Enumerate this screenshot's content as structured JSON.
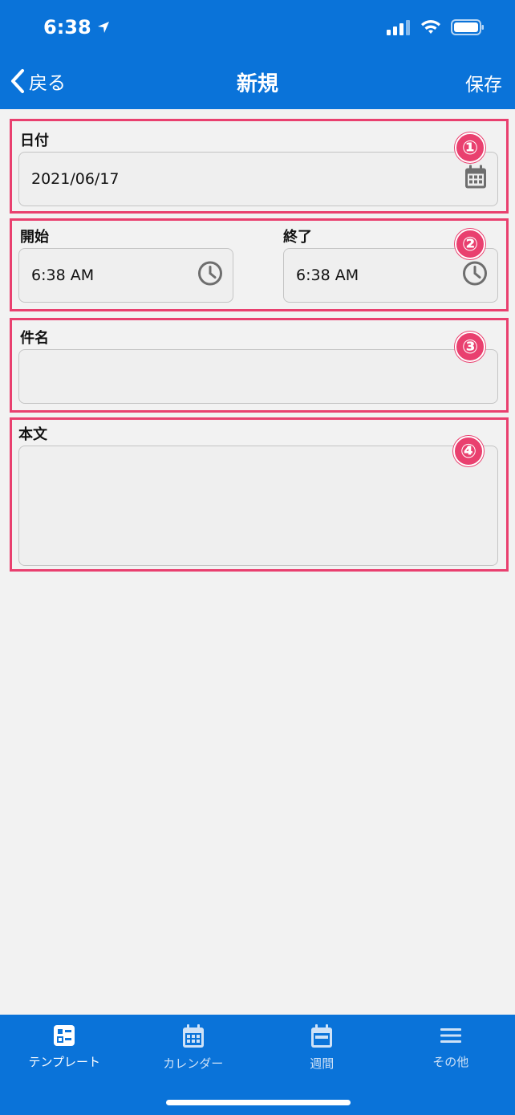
{
  "status_bar": {
    "time": "6:38"
  },
  "nav": {
    "back_label": "戻る",
    "title": "新規",
    "save_label": "保存"
  },
  "form": {
    "date": {
      "label": "日付",
      "value": "2021/06/17",
      "badge": "①"
    },
    "start": {
      "label": "開始",
      "value": "6:38 AM"
    },
    "end": {
      "label": "終了",
      "value": "6:38 AM"
    },
    "time_badge": "②",
    "subject": {
      "label": "件名",
      "value": "",
      "badge": "③"
    },
    "body": {
      "label": "本文",
      "value": "",
      "badge": "④"
    }
  },
  "tabs": [
    {
      "label": "テンプレート",
      "icon": "template-icon"
    },
    {
      "label": "カレンダー",
      "icon": "calendar-icon"
    },
    {
      "label": "週間",
      "icon": "week-icon"
    },
    {
      "label": "その他",
      "icon": "menu-icon"
    }
  ],
  "colors": {
    "primary": "#0a73d9",
    "highlight": "#e9406f",
    "background": "#f2f2f2"
  }
}
